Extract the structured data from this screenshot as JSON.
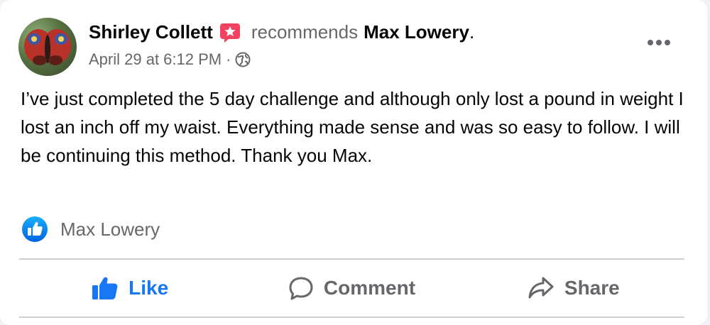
{
  "post": {
    "author": "Shirley Collett",
    "verb": "recommends",
    "target": "Max Lowery",
    "period": ".",
    "timestamp": "April 29 at 6:12 PM",
    "separator": "·",
    "privacy_icon": "globe-icon",
    "body": "I’ve just completed the 5 day challenge and although only lost a pound in weight I lost an inch off my waist. Everything made sense and was so easy to follow. I will be continuing this method. Thank you Max."
  },
  "reactions": {
    "icon": "like-reaction-icon",
    "name": "Max Lowery"
  },
  "actions": {
    "like_label": "Like",
    "comment_label": "Comment",
    "share_label": "Share"
  },
  "colors": {
    "primary_text": "#050505",
    "secondary_text": "#65676b",
    "brand_blue": "#1877f2",
    "recommend_badge": "#f3425f",
    "divider": "#ced0d4"
  }
}
